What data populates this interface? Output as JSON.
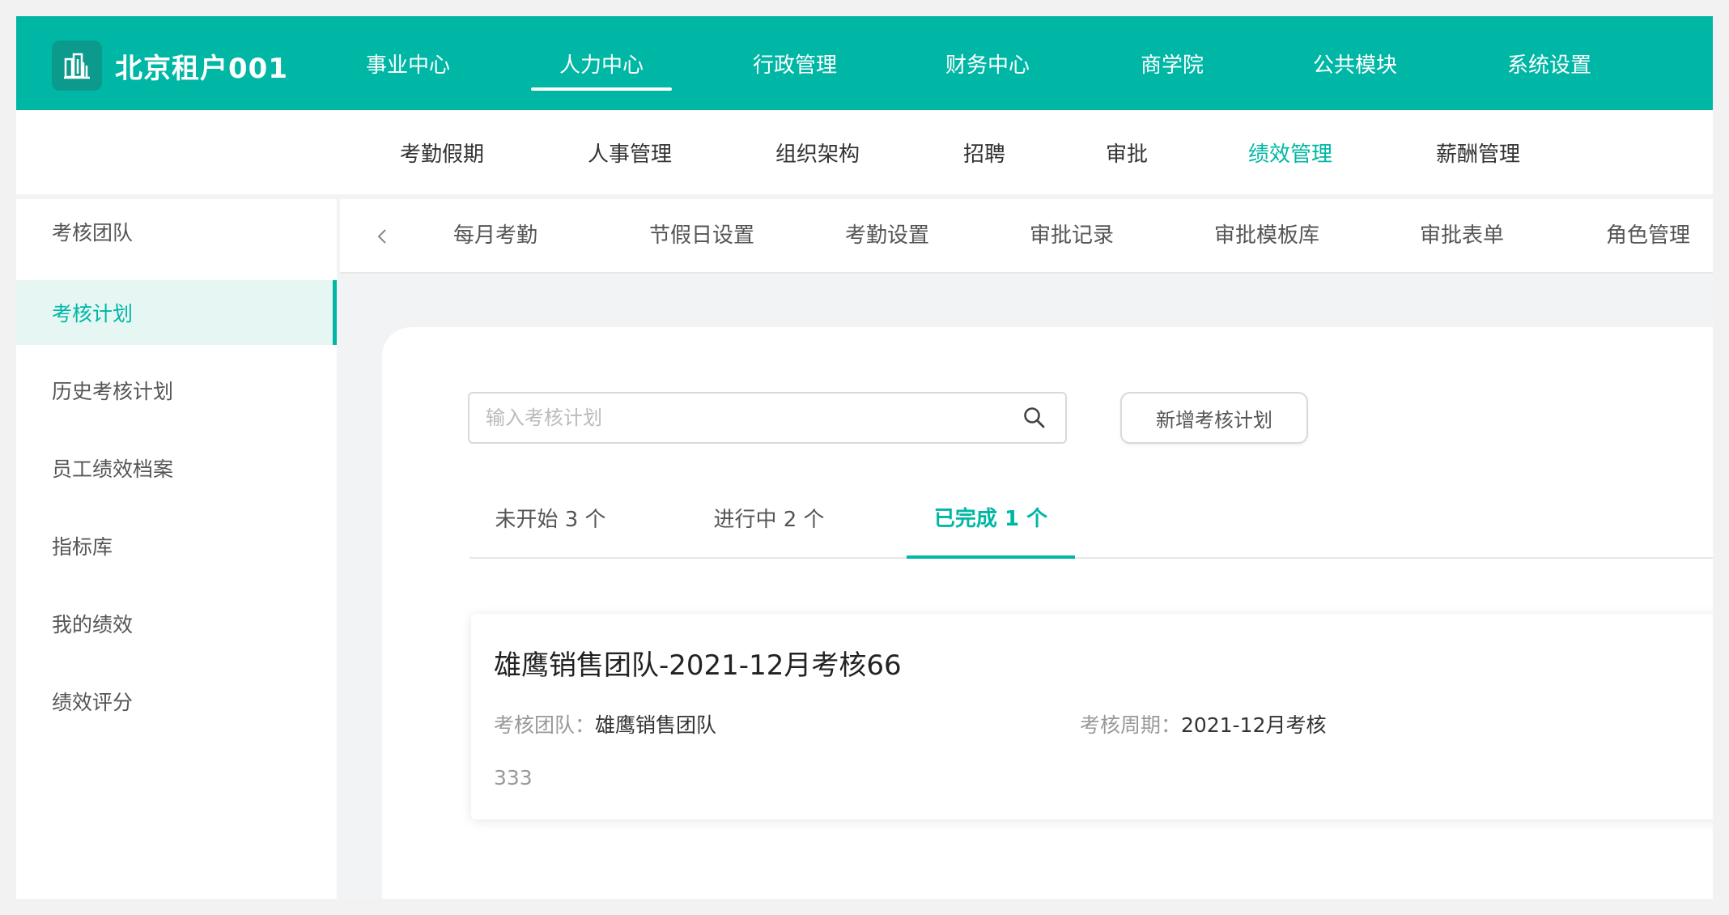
{
  "brand": {
    "name": "北京租户001",
    "logo_icon": "building-icon"
  },
  "top_nav": {
    "items": [
      {
        "label": "事业中心"
      },
      {
        "label": "人力中心",
        "active": true
      },
      {
        "label": "行政管理"
      },
      {
        "label": "财务中心"
      },
      {
        "label": "商学院"
      },
      {
        "label": "公共模块"
      },
      {
        "label": "系统设置"
      }
    ]
  },
  "sub_nav": {
    "items": [
      {
        "label": "考勤假期"
      },
      {
        "label": "人事管理"
      },
      {
        "label": "组织架构"
      },
      {
        "label": "招聘"
      },
      {
        "label": "审批"
      },
      {
        "label": "绩效管理",
        "active": true
      },
      {
        "label": "薪酬管理"
      }
    ]
  },
  "sidebar": {
    "items": [
      {
        "label": "考核团队"
      },
      {
        "label": "考核计划",
        "active": true
      },
      {
        "label": "历史考核计划"
      },
      {
        "label": "员工绩效档案"
      },
      {
        "label": "指标库"
      },
      {
        "label": "我的绩效"
      },
      {
        "label": "绩效评分"
      }
    ]
  },
  "tab_bar": {
    "prev_label": "<",
    "items": [
      {
        "label": "每月考勤"
      },
      {
        "label": "节假日设置"
      },
      {
        "label": "考勤设置"
      },
      {
        "label": "审批记录"
      },
      {
        "label": "审批模板库"
      },
      {
        "label": "审批表单"
      },
      {
        "label": "角色管理"
      }
    ]
  },
  "search": {
    "placeholder": "输入考核计划",
    "value": "",
    "icon": "search-icon"
  },
  "add_button": {
    "label": "新增考核计划"
  },
  "status_tabs": {
    "items": [
      {
        "label": "未开始 3 个"
      },
      {
        "label": "进行中 2 个"
      },
      {
        "label": "已完成 1 个",
        "active": true
      }
    ]
  },
  "plan": {
    "title": "雄鹰销售团队-2021-12月考核66",
    "team_label": "考核团队：",
    "team_value": "雄鹰销售团队",
    "period_label": "考核周期：",
    "period_value": "2021-12月考核",
    "description": "333"
  },
  "colors": {
    "accent": "#00b7a6",
    "accent_dark": "#0c9a8c",
    "active_bg": "#e6f6f3"
  }
}
